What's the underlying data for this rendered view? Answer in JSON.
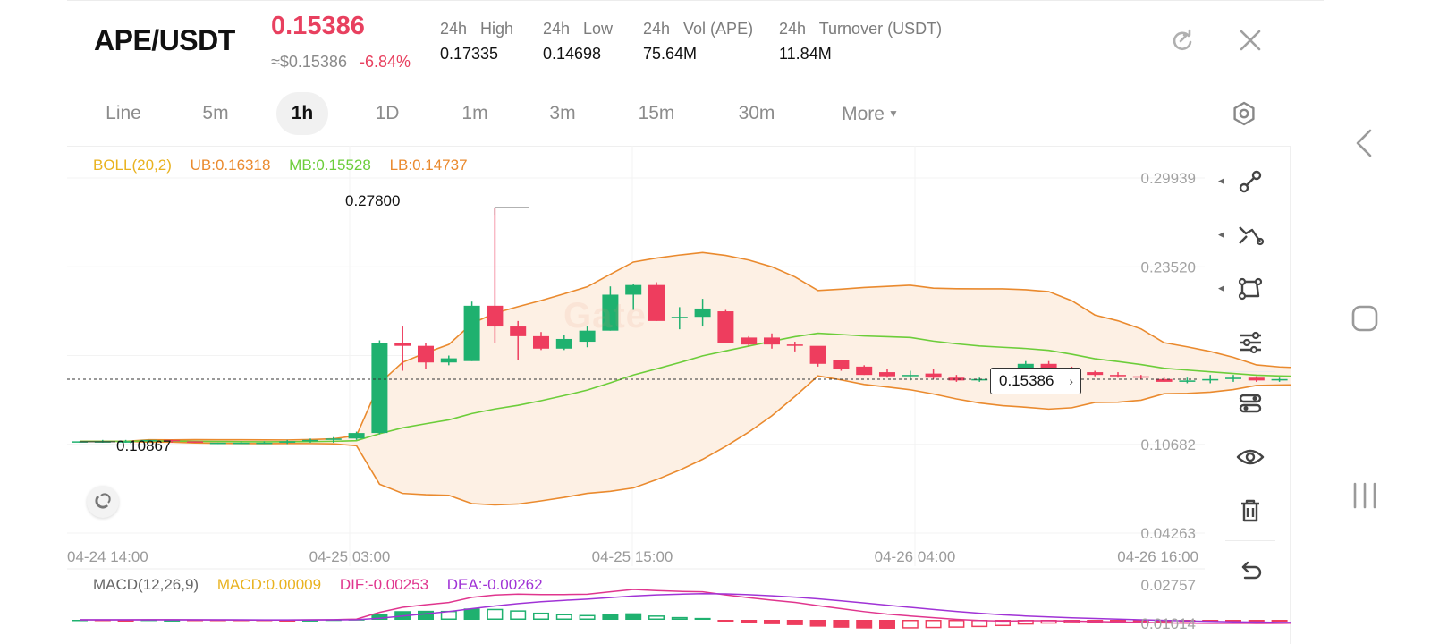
{
  "header": {
    "pair": "APE/USDT",
    "price": "0.15386",
    "usd_price": "≈$0.15386",
    "change": "-6.84%",
    "stats": [
      {
        "key": "24h   High",
        "value": "0.17335"
      },
      {
        "key": "24h   Low",
        "value": "0.14698"
      },
      {
        "key": "24h   Vol (APE)",
        "value": "75.64M"
      },
      {
        "key": "24h   Turnover (USDT)",
        "value": "11.84M"
      }
    ]
  },
  "tabs": [
    {
      "label": "Line"
    },
    {
      "label": "5m"
    },
    {
      "label": "1h",
      "active": true
    },
    {
      "label": "1D"
    },
    {
      "label": "1m"
    },
    {
      "label": "3m"
    },
    {
      "label": "15m"
    },
    {
      "label": "30m"
    },
    {
      "label": "More"
    }
  ],
  "boll": {
    "name": "BOLL(20,2)",
    "ub": "UB:0.16318",
    "mb": "MB:0.15528",
    "lb": "LB:0.14737"
  },
  "macd": {
    "name": "MACD(12,26,9)",
    "macd": "MACD:0.00009",
    "dif": "DIF:-0.00253",
    "dea": "DEA:-0.00262"
  },
  "markers": {
    "current_price": "0.15386",
    "period_high": "0.27800",
    "period_low": "0.10867"
  },
  "watermark": "Gate",
  "colors": {
    "up": "#1fb16f",
    "down": "#ee3d5e",
    "boll_name": "#e9b21f",
    "boll_ub": "#ea8a2e",
    "boll_mb": "#6ccd3a",
    "boll_lb": "#ea8a2e",
    "macd_name": "#666666",
    "macd_val": "#e9b21f",
    "dif": "#e0358e",
    "dea": "#a033d6",
    "band_fill": "#fdf0e4"
  },
  "tools": [
    "connect-line-icon",
    "trend-line-icon",
    "shape-icon",
    "indicator-settings-icon",
    "style-settings-icon",
    "visibility-icon",
    "delete-icon",
    "undo-icon"
  ],
  "chart_data": {
    "type": "candlestick",
    "y_axis_labels": [
      "0.29939",
      "0.23520",
      "0.17101",
      "0.10682",
      "0.04263"
    ],
    "macd_axis_labels": [
      "0.02757",
      "0.01014"
    ],
    "x_axis_labels": [
      "04-24 14:00",
      "04-25 03:00",
      "04-25 15:00",
      "04-26 04:00",
      "04-26 16:00"
    ],
    "candles": [
      [
        0.109,
        0.109,
        0.108,
        0.109
      ],
      [
        0.109,
        0.11,
        0.108,
        0.109
      ],
      [
        0.109,
        0.11,
        0.108,
        0.109
      ],
      [
        0.109,
        0.11,
        0.108,
        0.11
      ],
      [
        0.11,
        0.11,
        0.108,
        0.109
      ],
      [
        0.109,
        0.109,
        0.108,
        0.108
      ],
      [
        0.108,
        0.108,
        0.107,
        0.108
      ],
      [
        0.108,
        0.109,
        0.107,
        0.108
      ],
      [
        0.108,
        0.109,
        0.108,
        0.108
      ],
      [
        0.108,
        0.11,
        0.107,
        0.109
      ],
      [
        0.109,
        0.111,
        0.108,
        0.11
      ],
      [
        0.11,
        0.112,
        0.108,
        0.111
      ],
      [
        0.111,
        0.116,
        0.11,
        0.115
      ],
      [
        0.115,
        0.182,
        0.114,
        0.18
      ],
      [
        0.18,
        0.192,
        0.16,
        0.178
      ],
      [
        0.178,
        0.18,
        0.161,
        0.166
      ],
      [
        0.166,
        0.171,
        0.164,
        0.169
      ],
      [
        0.167,
        0.21,
        0.167,
        0.207
      ],
      [
        0.207,
        0.278,
        0.18,
        0.192
      ],
      [
        0.192,
        0.196,
        0.168,
        0.185
      ],
      [
        0.185,
        0.188,
        0.175,
        0.176
      ],
      [
        0.176,
        0.186,
        0.175,
        0.183
      ],
      [
        0.181,
        0.192,
        0.177,
        0.189
      ],
      [
        0.189,
        0.221,
        0.189,
        0.215
      ],
      [
        0.215,
        0.223,
        0.204,
        0.222
      ],
      [
        0.222,
        0.224,
        0.196,
        0.196
      ],
      [
        0.199,
        0.206,
        0.19,
        0.199
      ],
      [
        0.199,
        0.212,
        0.192,
        0.205
      ],
      [
        0.203,
        0.204,
        0.182,
        0.18
      ],
      [
        0.184,
        0.185,
        0.178,
        0.179
      ],
      [
        0.184,
        0.187,
        0.176,
        0.179
      ],
      [
        0.179,
        0.181,
        0.174,
        0.178
      ],
      [
        0.178,
        0.174,
        0.163,
        0.165
      ],
      [
        0.168,
        0.168,
        0.16,
        0.161
      ],
      [
        0.163,
        0.164,
        0.157,
        0.157
      ],
      [
        0.159,
        0.161,
        0.155,
        0.156
      ],
      [
        0.156,
        0.16,
        0.153,
        0.157
      ],
      [
        0.158,
        0.161,
        0.154,
        0.155
      ],
      [
        0.155,
        0.157,
        0.152,
        0.153
      ],
      [
        0.153,
        0.155,
        0.152,
        0.154
      ],
      [
        0.154,
        0.158,
        0.153,
        0.157
      ],
      [
        0.157,
        0.167,
        0.157,
        0.165
      ],
      [
        0.165,
        0.167,
        0.16,
        0.162
      ],
      [
        0.162,
        0.163,
        0.158,
        0.159
      ],
      [
        0.159,
        0.16,
        0.156,
        0.157
      ],
      [
        0.157,
        0.159,
        0.155,
        0.156
      ],
      [
        0.156,
        0.157,
        0.154,
        0.155
      ],
      [
        0.154,
        0.155,
        0.152,
        0.152
      ],
      [
        0.152,
        0.155,
        0.151,
        0.153
      ],
      [
        0.153,
        0.157,
        0.151,
        0.154
      ],
      [
        0.154,
        0.157,
        0.152,
        0.155
      ],
      [
        0.155,
        0.156,
        0.152,
        0.153
      ],
      [
        0.153,
        0.155,
        0.152,
        0.154
      ],
      [
        0.154,
        0.156,
        0.153,
        0.155
      ],
      [
        0.155,
        0.157,
        0.153,
        0.156
      ],
      [
        0.156,
        0.157,
        0.153,
        0.154
      ],
      [
        0.154,
        0.155,
        0.152,
        0.154
      ]
    ]
  }
}
